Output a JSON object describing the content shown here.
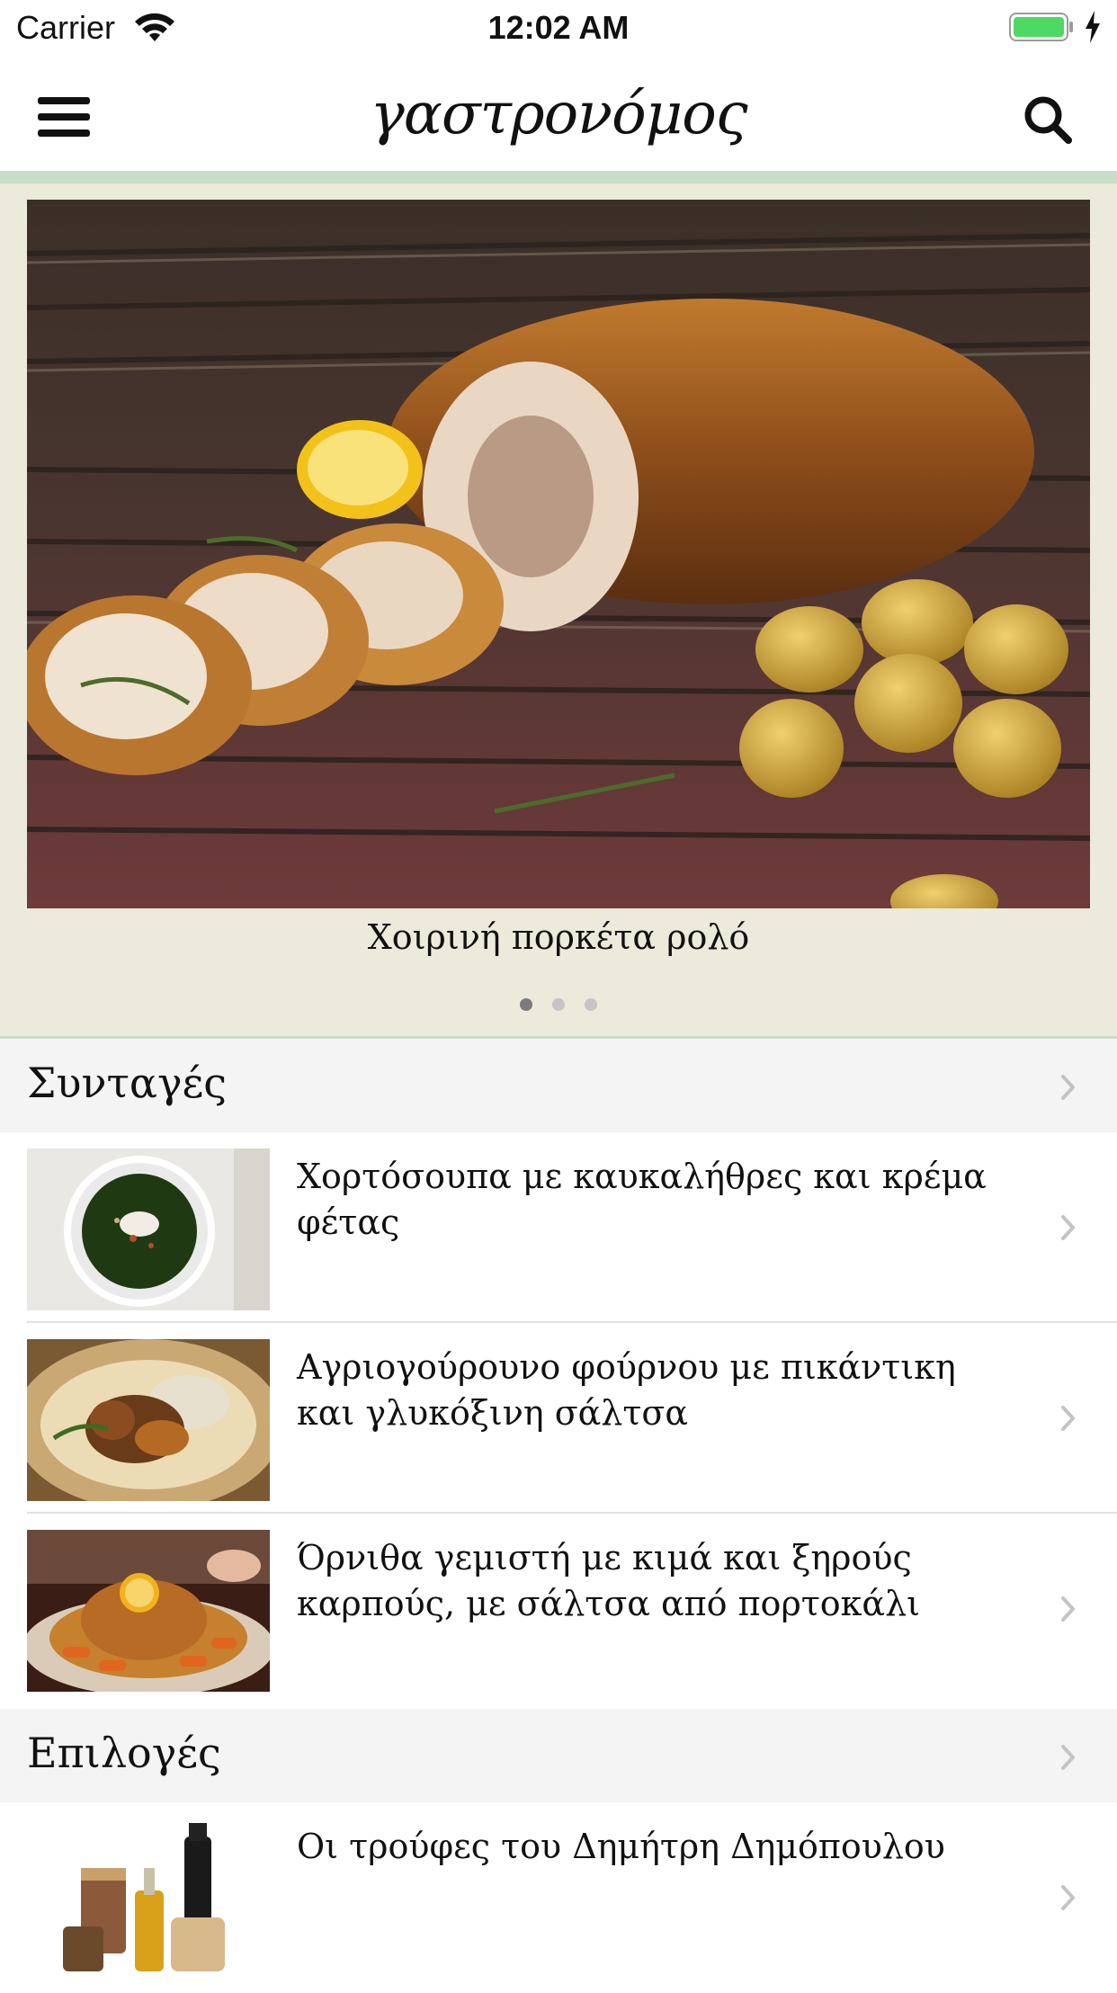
{
  "status_bar": {
    "carrier": "Carrier",
    "time": "12:02 AM",
    "battery_color": "#4cd964"
  },
  "nav": {
    "menu_icon": "hamburger-menu-icon",
    "logo": "γαστρονόμος",
    "search_icon": "search-icon",
    "accent_color": "#c7ddc9"
  },
  "carousel": {
    "caption": "Χοιρινή πορκέτα ρολό",
    "page_count": 3,
    "active_page": 1,
    "background": "#ebeadb"
  },
  "sections": [
    {
      "title": "Συνταγές",
      "items": [
        {
          "title": "Χορτόσουπα με καυκαλήθρες και κρέμα φέτας",
          "image": "green soup bowl"
        },
        {
          "title": "Αγριογούρουνο φούρνου με πικάντικη και γλυκόξινη σάλτσα",
          "image": "roast boar plate"
        },
        {
          "title": "Όρνιθα γεμιστή με κιμά και ξηρούς καρπούς, με σάλτσα από πορτοκάλι",
          "image": "stuffed chicken platter"
        }
      ]
    },
    {
      "title": "Επιλογές",
      "items": [
        {
          "title": "Οι τρούφες του Δημήτρη Δημόπουλου",
          "image": "truffle jars and bottles"
        }
      ]
    }
  ]
}
